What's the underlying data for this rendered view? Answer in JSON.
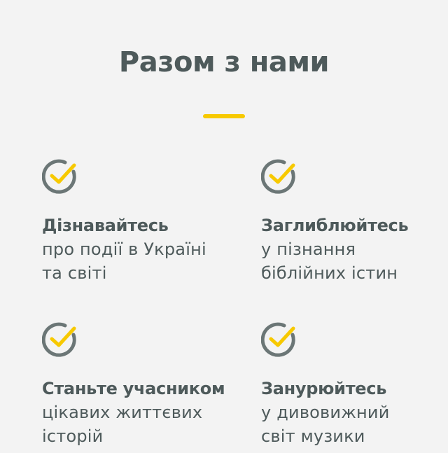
{
  "section": {
    "title": "Разом з нами",
    "accent_color": "#f7c900",
    "text_color": "#4e5a5b",
    "icon_ring_color": "#6b7676"
  },
  "features": [
    {
      "icon": "check-circle-icon",
      "title": "Дізнавайтесь",
      "description": "про події в Україні\nта світі"
    },
    {
      "icon": "check-circle-icon",
      "title": "Заглиблюйтесь",
      "description": "у пізнання\nбіблійних істин"
    },
    {
      "icon": "check-circle-icon",
      "title": "Станьте учасником",
      "description": "цікавих життєвих\nісторій"
    },
    {
      "icon": "check-circle-icon",
      "title": "Занурюйтесь",
      "description": "у дивовижний\nсвіт музики"
    }
  ]
}
